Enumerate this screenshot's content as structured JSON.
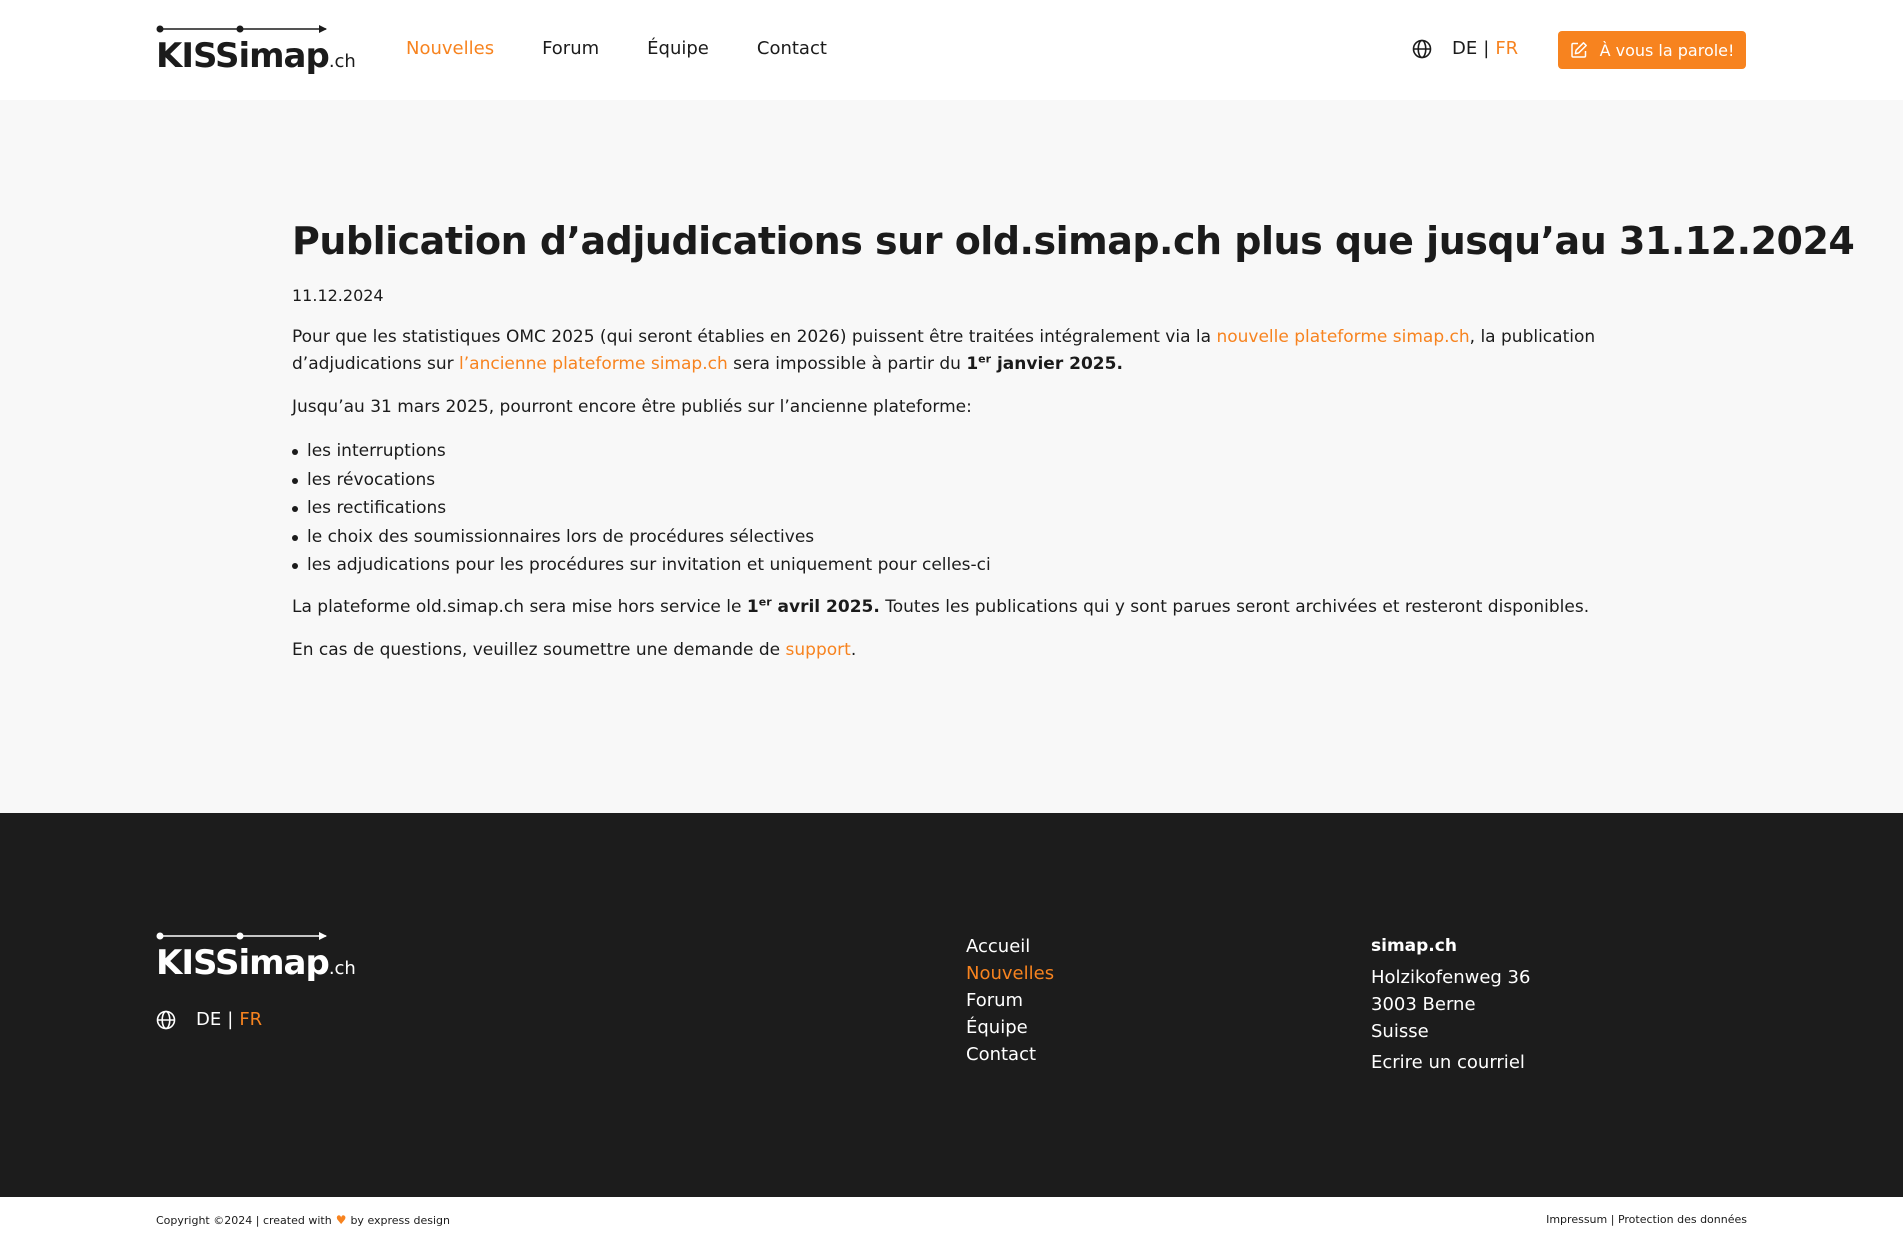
{
  "colors": {
    "accent": "#f7831f",
    "dark": "#1c1c1c",
    "content_bg": "#f8f8f8"
  },
  "header": {
    "logo": {
      "text": "KISSimap",
      "suffix": ".ch"
    },
    "nav": [
      {
        "label": "Nouvelles",
        "active": true
      },
      {
        "label": "Forum"
      },
      {
        "label": "Équipe"
      },
      {
        "label": "Contact"
      }
    ],
    "lang": {
      "icon": "globe-icon",
      "de": "DE",
      "separator": "|",
      "fr": "FR",
      "active": "FR"
    },
    "cta": {
      "icon": "edit-icon",
      "label": "À vous la parole!"
    }
  },
  "article": {
    "title": "Publication d’adjudications sur old.simap.ch plus que jusqu’au 31.12.2024",
    "date": "11.12.2024",
    "p1": {
      "t1": "Pour que les statistiques OMC 2025 (qui seront établies en 2026) puissent être traitées intégralement via la ",
      "link1": "nouvelle plateforme simap.ch",
      "t2": ", la publication d’adjudications sur ",
      "link2": "l’ancienne plateforme simap.ch",
      "t3": " sera impossible à partir du ",
      "b_num": "1",
      "b_sup": "er",
      "b_rest": " janvier 2025."
    },
    "p2": "Jusqu’au 31 mars 2025, pourront encore être publiés sur l’ancienne plateforme:",
    "list": [
      "les interruptions",
      "les révocations",
      "les rectifications",
      "le choix des soumissionnaires lors de procédures sélectives",
      "les adjudications pour les procédures sur invitation et uniquement pour celles-ci"
    ],
    "p3": {
      "t1": "La plateforme old.simap.ch sera mise hors service le ",
      "b_num": "1",
      "b_sup": "er",
      "b_rest": " avril 2025.",
      "t2": " Toutes les publications qui y sont parues seront archivées et resteront disponibles."
    },
    "p4": {
      "t1": "En cas de questions, veuillez soumettre une demande de ",
      "link": "support",
      "t2": "."
    }
  },
  "footer": {
    "nav": [
      {
        "label": "Accueil"
      },
      {
        "label": "Nouvelles",
        "active": true
      },
      {
        "label": "Forum"
      },
      {
        "label": "Équipe"
      },
      {
        "label": "Contact"
      }
    ],
    "address": {
      "title": "simap.ch",
      "street": "Holzikofenweg 36",
      "city": "3003 Berne",
      "country": "Suisse",
      "email_label": "Ecrire un courriel"
    }
  },
  "bottom": {
    "copyright_pre": "Copyright ©2024 | created with",
    "heart_icon": "heart-icon",
    "copyright_post": "by express design",
    "impressum": "Impressum",
    "separator": "|",
    "privacy": "Protection des données"
  }
}
